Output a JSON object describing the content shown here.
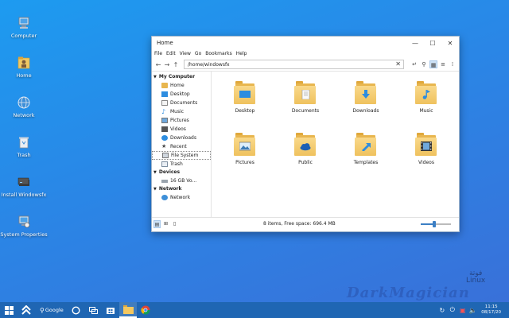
{
  "desktop": {
    "icons": [
      {
        "label": "Computer",
        "icon": "computer-icon"
      },
      {
        "label": "Home",
        "icon": "home-folder-icon"
      },
      {
        "label": "Network",
        "icon": "network-icon"
      },
      {
        "label": "Trash",
        "icon": "trash-icon"
      },
      {
        "label": "Install Windowsfx",
        "icon": "install-drive-icon"
      },
      {
        "label": "System Properties",
        "icon": "system-properties-icon"
      }
    ]
  },
  "window": {
    "title": "Home",
    "controls": {
      "minimize": "—",
      "maximize": "☐",
      "close": "✕"
    },
    "menu": [
      "File",
      "Edit",
      "View",
      "Go",
      "Bookmarks",
      "Help"
    ],
    "address": "/home/windowsfx",
    "sidebar": {
      "sections": [
        {
          "title": "My Computer",
          "items": [
            "Home",
            "Desktop",
            "Documents",
            "Music",
            "Pictures",
            "Videos",
            "Downloads",
            "Recent",
            "File System",
            "Trash"
          ]
        },
        {
          "title": "Devices",
          "items": [
            "16 GB Vo..."
          ]
        },
        {
          "title": "Network",
          "items": [
            "Network"
          ]
        }
      ],
      "selected": "File System"
    },
    "files": [
      {
        "label": "Desktop",
        "icon": "desktop-folder-icon"
      },
      {
        "label": "Documents",
        "icon": "documents-folder-icon"
      },
      {
        "label": "Downloads",
        "icon": "downloads-folder-icon"
      },
      {
        "label": "Music",
        "icon": "music-folder-icon"
      },
      {
        "label": "Pictures",
        "icon": "pictures-folder-icon"
      },
      {
        "label": "Public",
        "icon": "public-folder-icon"
      },
      {
        "label": "Templates",
        "icon": "templates-folder-icon"
      },
      {
        "label": "Videos",
        "icon": "videos-folder-icon"
      }
    ],
    "status": "8 items, Free space: 696.4 MB",
    "zoom_level": 0.45
  },
  "taskbar": {
    "search_label": "Google",
    "clock_time": "11:15",
    "clock_date": "08/17/20"
  },
  "watermark": {
    "brand": "DarkMagician",
    "small_top": "فوتة",
    "small_bottom": "Linux"
  },
  "colors": {
    "accent": "#2a86e6",
    "taskbar": "#1f66b3",
    "folder": "#efc25e"
  }
}
